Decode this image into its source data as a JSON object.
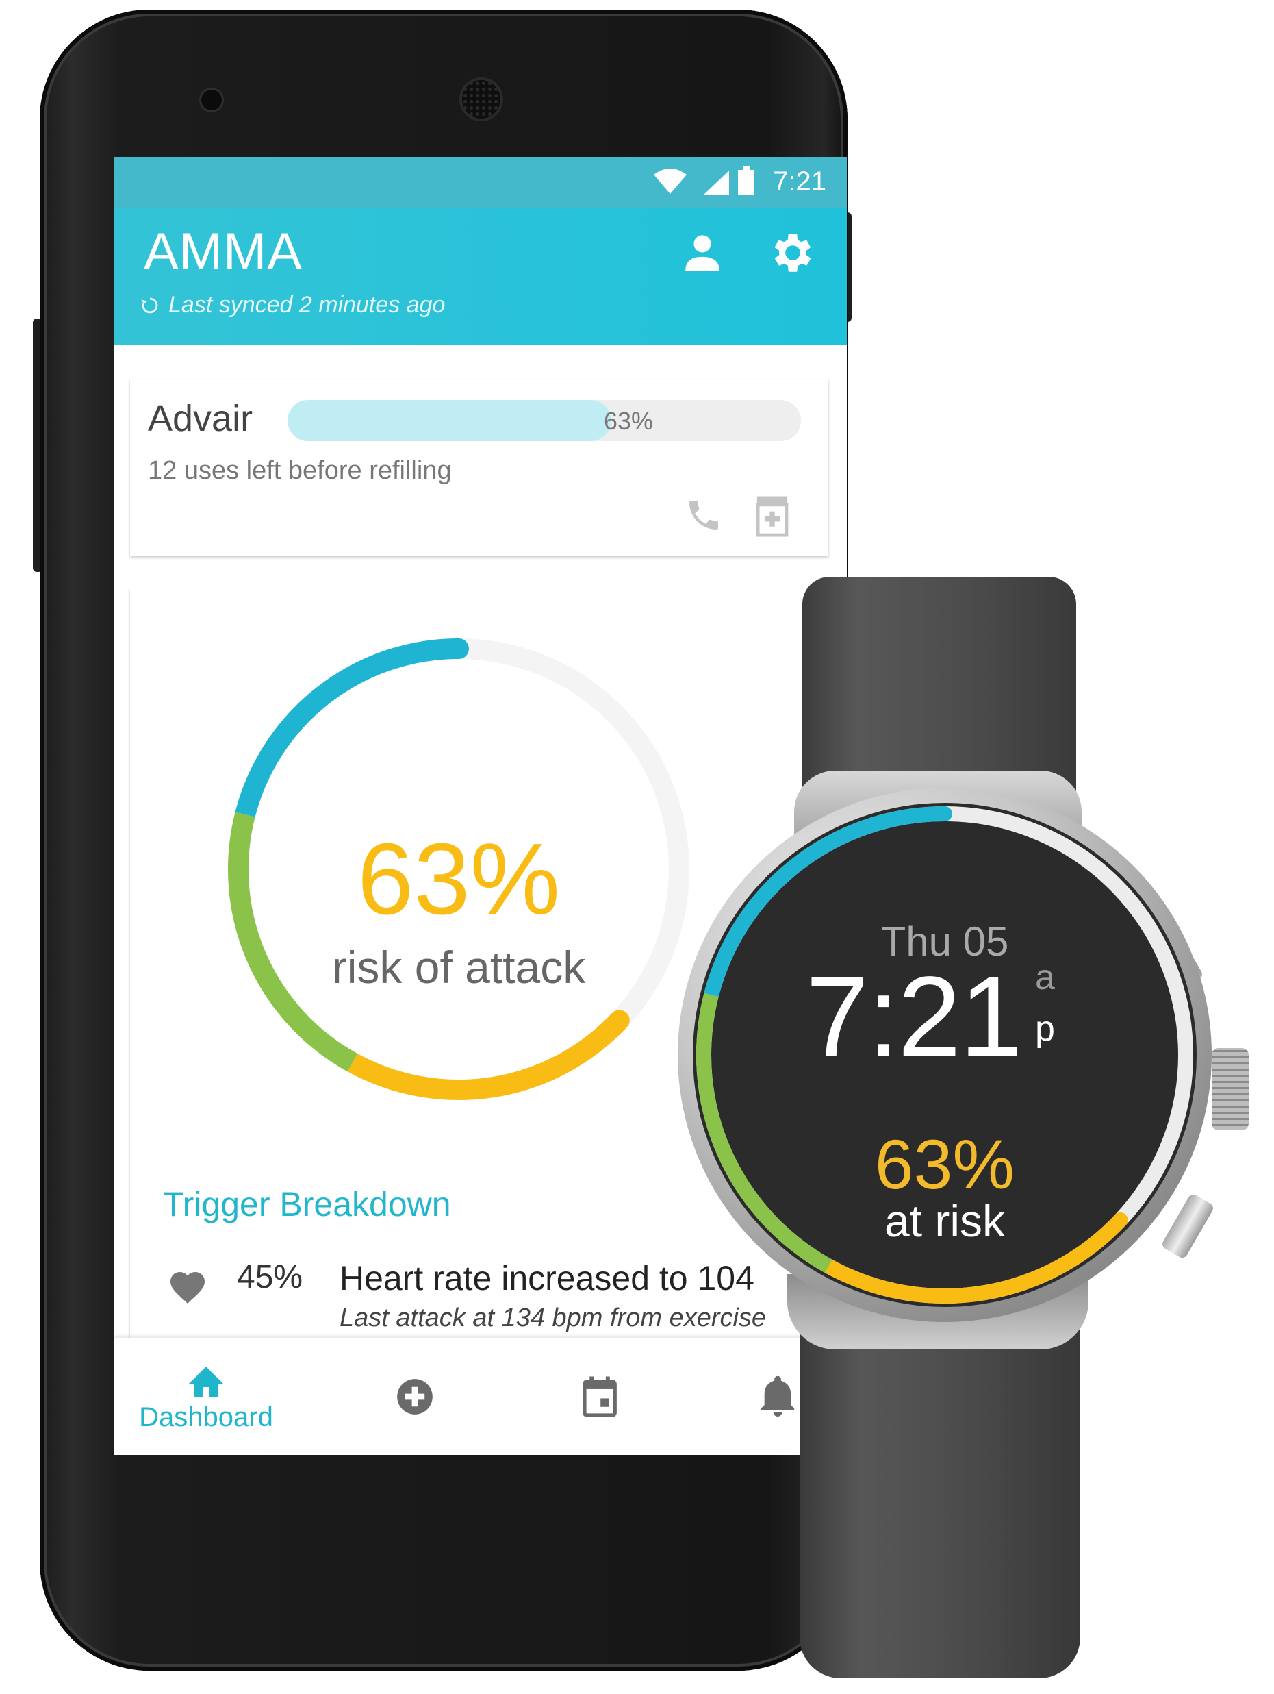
{
  "status_bar": {
    "time": "7:21"
  },
  "app_bar": {
    "title": "AMMA",
    "sync_text": "Last synced 2 minutes ago"
  },
  "medication": {
    "name": "Advair",
    "level": 0.63,
    "level_label": "63%",
    "subtitle": "12 uses left before refilling"
  },
  "risk": {
    "percent_label": "63%",
    "label": "risk of attack",
    "value": 0.63,
    "segment_colors": [
      "#f9bc15",
      "#8bc34a",
      "#20b4d3"
    ],
    "track_color": "#f4f4f4"
  },
  "triggers": {
    "title": "Trigger Breakdown",
    "items": [
      {
        "icon": "heart-icon",
        "percent": "45%",
        "text": "Heart rate increased to 104",
        "detail": "Last attack at 134 bpm from exercise"
      }
    ]
  },
  "bottom_nav": {
    "items": [
      {
        "icon": "home-icon",
        "label": "Dashboard",
        "active": true
      },
      {
        "icon": "add-circle-icon",
        "label": ""
      },
      {
        "icon": "calendar-icon",
        "label": ""
      },
      {
        "icon": "bell-icon",
        "label": ""
      }
    ]
  },
  "watch": {
    "date": "Thu 05",
    "time": "7:21",
    "am": "a",
    "pm": "p",
    "percent_label": "63%",
    "label": "at risk"
  },
  "colors": {
    "accent": "#1fc2da",
    "risk_yellow": "#f9bc15",
    "risk_green": "#8bc34a",
    "risk_blue": "#20b4d3"
  }
}
